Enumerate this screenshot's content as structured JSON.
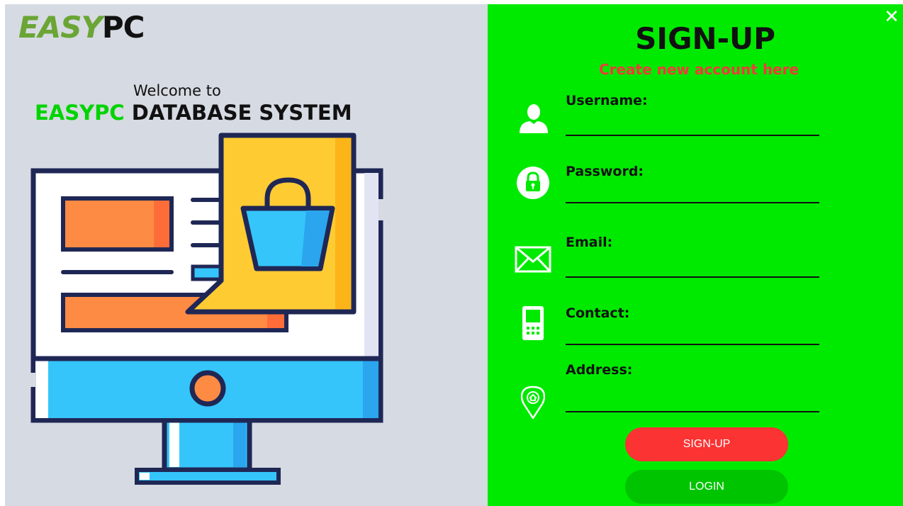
{
  "window": {
    "close_glyph": "✕"
  },
  "brand": {
    "logo_part1": "EASY",
    "logo_part2": "PC",
    "welcome_line": "Welcome to",
    "title_brand": "EASYPC",
    "title_rest": " DATABASE SYSTEM"
  },
  "signup": {
    "heading": "SIGN-UP",
    "subheading": "Create new account here",
    "fields": [
      {
        "label": "Username:",
        "icon": "user-icon",
        "value": ""
      },
      {
        "label": "Password:",
        "icon": "lock-icon",
        "value": ""
      },
      {
        "label": "Email:",
        "icon": "envelope-icon",
        "value": ""
      },
      {
        "label": "Contact:",
        "icon": "mobile-phone-icon",
        "value": ""
      },
      {
        "label": "Address:",
        "icon": "location-pin-icon",
        "value": ""
      }
    ],
    "signup_button": "SIGN-UP",
    "login_button": "LOGIN"
  },
  "colors": {
    "left_bg": "#d6dae2",
    "right_bg": "#00ea00",
    "accent_red": "#fb3333",
    "login_green": "#00c400",
    "brand_green": "#00d400"
  }
}
